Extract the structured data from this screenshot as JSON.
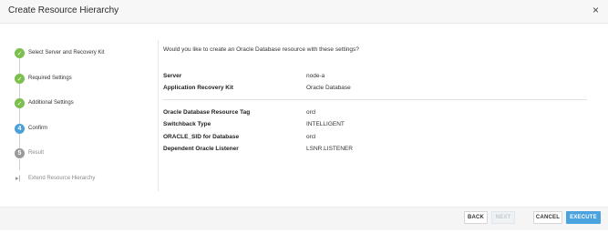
{
  "dialog": {
    "title": "Create Resource Hierarchy",
    "close_glyph": "×"
  },
  "steps": [
    {
      "label": "Select Server and Recovery Kit",
      "state": "done",
      "icon": "check-icon",
      "glyph": "✓"
    },
    {
      "label": "Required Settings",
      "state": "done",
      "icon": "check-icon",
      "glyph": "✓"
    },
    {
      "label": "Additional Settings",
      "state": "done",
      "icon": "check-icon",
      "glyph": "✓"
    },
    {
      "label": "Confirm",
      "state": "current",
      "icon": "step-number-icon",
      "glyph": "4"
    },
    {
      "label": "Result",
      "state": "pending",
      "icon": "step-number-icon",
      "glyph": "5"
    },
    {
      "label": "Extend Resource Hierarchy",
      "state": "pending",
      "icon": "skip-arrow-icon",
      "glyph": "▸|"
    }
  ],
  "main": {
    "question": "Would you like to create an Oracle Database resource with these settings?",
    "group1": [
      {
        "key": "Server",
        "value": "node-a"
      },
      {
        "key": "Application Recovery Kit",
        "value": "Oracle Database"
      }
    ],
    "group2": [
      {
        "key": "Oracle Database Resource Tag",
        "value": "orcl"
      },
      {
        "key": "Switchback Type",
        "value": "INTELLIGENT"
      },
      {
        "key": "ORACLE_SID for Database",
        "value": "orcl"
      },
      {
        "key": "Dependent Oracle Listener",
        "value": "LSNR.LISTENER"
      }
    ]
  },
  "footer": {
    "back_label": "BACK",
    "next_label": "NEXT",
    "cancel_label": "CANCEL",
    "execute_label": "EXECUTE"
  },
  "colors": {
    "done": "#7bbf4e",
    "current": "#4aa0d8",
    "pending": "#9a9a9a",
    "execute": "#4aa3df"
  }
}
